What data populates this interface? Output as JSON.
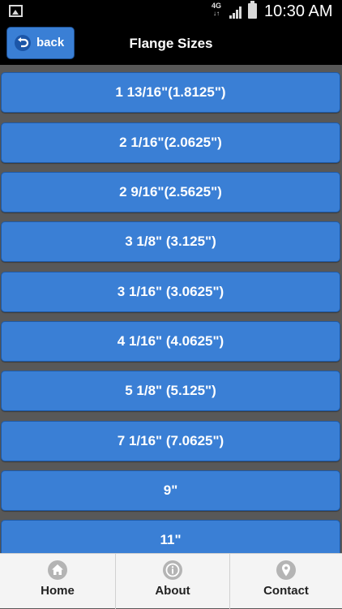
{
  "status_bar": {
    "network": "4G",
    "network_arrows": "↓↑",
    "time": "10:30 AM"
  },
  "header": {
    "back_label": "back",
    "title": "Flange Sizes"
  },
  "sizes": [
    "1 13/16\"(1.8125\")",
    "2 1/16\"(2.0625\")",
    "2 9/16\"(2.5625\")",
    "3 1/8\" (3.125\")",
    "3 1/16\" (3.0625\")",
    "4 1/16\" (4.0625\")",
    "5 1/8\" (5.125\")",
    "7 1/16\" (7.0625\")",
    "9\"",
    "11\""
  ],
  "bottom_nav": {
    "items": [
      {
        "label": "Home",
        "icon": "home-icon"
      },
      {
        "label": "About",
        "icon": "info-icon"
      },
      {
        "label": "Contact",
        "icon": "location-pin-icon"
      }
    ]
  },
  "colors": {
    "accent": "#3a7fd5",
    "background": "#585858",
    "bar": "#000000",
    "nav_background": "#f4f4f4"
  }
}
